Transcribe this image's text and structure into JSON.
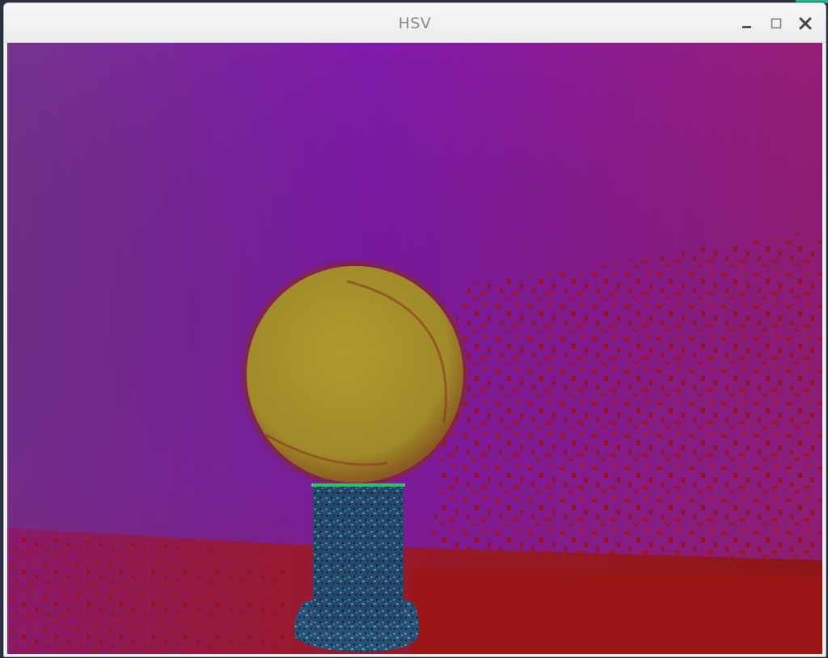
{
  "window": {
    "title": "HSV"
  },
  "controls": {
    "minimize_icon": "minimize-icon",
    "maximize_icon": "maximize-icon",
    "close_icon": "close-icon"
  },
  "image": {
    "colors": {
      "background_top_left": "#7a3a9a",
      "background_purple": "#8a1ab8",
      "background_magenta": "#a0207a",
      "floor_red": "#9a1a1a",
      "ball": "#a89a2a",
      "ball_edge": "#8a2a1a",
      "pedestal": "#2a5a7a",
      "pedestal_speckle": "#3a9a8a"
    }
  }
}
